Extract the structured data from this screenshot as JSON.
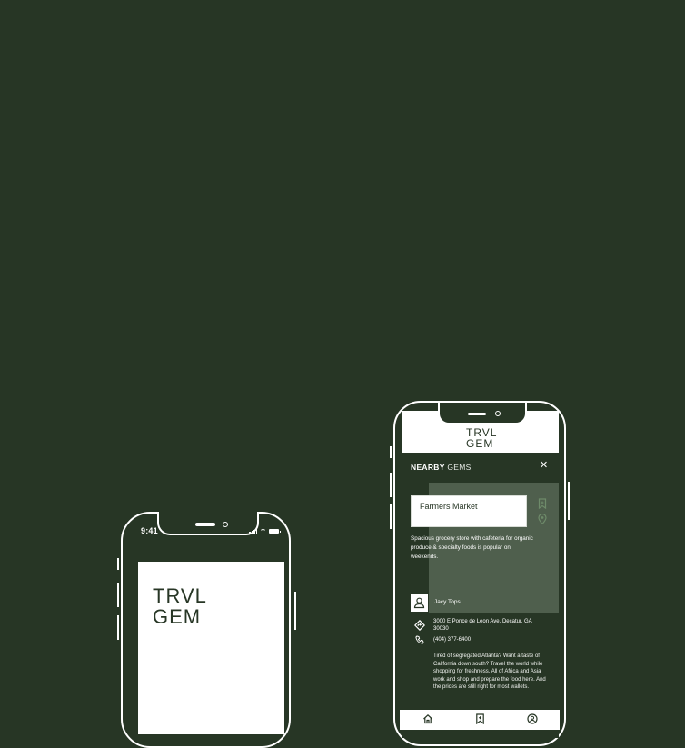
{
  "phone1": {
    "status_time": "9:41",
    "logo_line1": "TRVL",
    "logo_line2": "GEM"
  },
  "phone2": {
    "logo_line1": "TRVL",
    "logo_line2": "GEM",
    "section_title_bold": "NEARBY",
    "section_title_rest": " GEMS",
    "place": {
      "name": "Farmers Market",
      "short_description": "Spacious grocery store with cafeteria for organic produce & specialty foods is popular on weekends.",
      "contributor": "Jacy Tops",
      "address": "3000 E Ponce de Leon Ave, Decatur, GA 30030",
      "phone": "(404) 377-6400",
      "review": "Tired of segregated Atlanta? Want a taste of California down south? Travel the world while shopping for freshness. All of Africa and Asia work and shop and prepare the food here. And the prices are still right for most wallets."
    },
    "tabs": [
      {
        "icon": "home-icon"
      },
      {
        "icon": "bookmark-icon"
      },
      {
        "icon": "profile-icon"
      }
    ]
  },
  "colors": {
    "background": "#273625",
    "surface": "#ffffff",
    "map_panel": "#4f5f4d"
  }
}
